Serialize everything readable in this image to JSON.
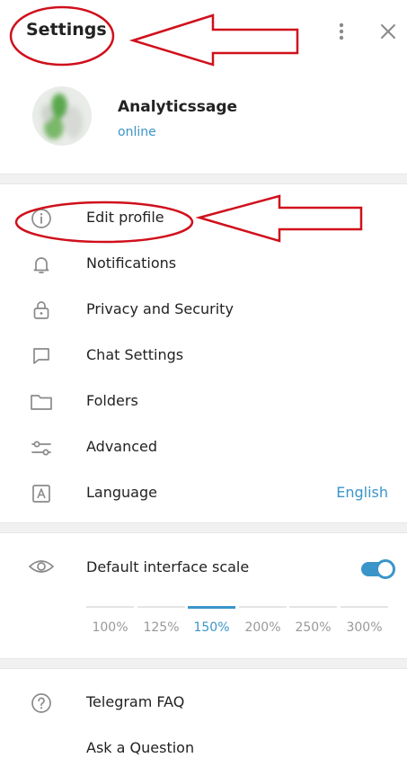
{
  "header": {
    "title": "Settings",
    "more_icon": "vertical-dots-icon",
    "close_icon": "close-icon"
  },
  "profile": {
    "name": "Analyticssage",
    "status": "online"
  },
  "menu": [
    {
      "label": "Edit profile",
      "icon": "info-icon"
    },
    {
      "label": "Notifications",
      "icon": "bell-icon"
    },
    {
      "label": "Privacy and Security",
      "icon": "lock-icon"
    },
    {
      "label": "Chat Settings",
      "icon": "chat-bubble-icon"
    },
    {
      "label": "Folders",
      "icon": "folder-icon"
    },
    {
      "label": "Advanced",
      "icon": "sliders-icon"
    },
    {
      "label": "Language",
      "icon": "letter-a-icon",
      "value": "English"
    }
  ],
  "scale": {
    "label": "Default interface scale",
    "icon": "eye-icon",
    "enabled": true,
    "options": [
      "100%",
      "125%",
      "150%",
      "200%",
      "250%",
      "300%"
    ],
    "selected": "150%"
  },
  "help": [
    {
      "label": "Telegram FAQ",
      "icon": "question-circle-icon"
    },
    {
      "label": "Ask a Question"
    }
  ],
  "colors": {
    "accent": "#3a95c9",
    "annotation": "#d0101c"
  }
}
